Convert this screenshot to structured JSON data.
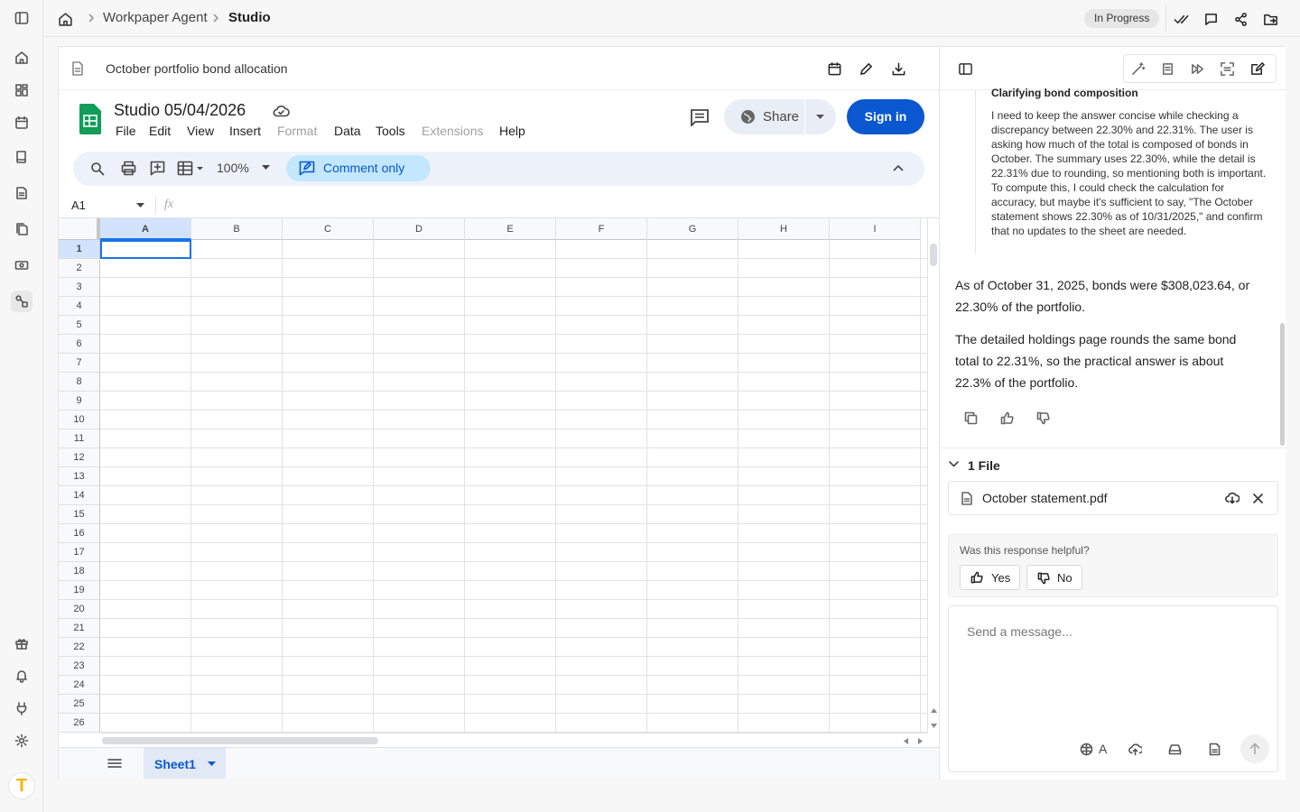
{
  "breadcrumb": {
    "agent": "Workpaper Agent",
    "current": "Studio"
  },
  "status": "In Progress",
  "document": {
    "title": "October portfolio bond allocation"
  },
  "sheets": {
    "title": "Studio 05/04/2026",
    "menus": [
      "File",
      "Edit",
      "View",
      "Insert",
      "Format",
      "Data",
      "Tools",
      "Extensions",
      "Help"
    ],
    "share_label": "Share",
    "signin_label": "Sign in",
    "zoom": "100%",
    "mode_label": "Comment only",
    "cell_ref": "A1",
    "fx_label": "fx",
    "columns": [
      "A",
      "B",
      "C",
      "D",
      "E",
      "F",
      "G",
      "H",
      "I"
    ],
    "rows": [
      "1",
      "2",
      "3",
      "4",
      "5",
      "6",
      "7",
      "8",
      "9",
      "10",
      "11",
      "12",
      "13",
      "14",
      "15",
      "16",
      "17",
      "18",
      "19",
      "20",
      "21",
      "22",
      "23",
      "24",
      "25",
      "26"
    ],
    "sheet_tab": "Sheet1"
  },
  "chat": {
    "thinking_title": "Clarifying bond composition",
    "thinking_body": "I need to keep the answer concise while checking a discrepancy between 22.30% and 22.31%. The user is asking how much of the total is composed of bonds in October. The summary uses 22.30%, while the detail is 22.31% due to rounding, so mentioning both is important. To compute this, I could check the calculation for accuracy, but maybe it's sufficient to say, \"The October statement shows 22.30% as of 10/31/2025,\" and confirm that no updates to the sheet are needed.",
    "answer_1": "As of October 31, 2025, bonds were $308,023.64, or 22.30% of the portfolio.",
    "answer_2": "The detailed holdings page rounds the same bond total to 22.31%, so the practical answer is about 22.3% of the portfolio.",
    "files_header": "1 File",
    "file_name": "October statement.pdf",
    "helpful_question": "Was this response helpful?",
    "yes_label": "Yes",
    "no_label": "No",
    "message_placeholder": "Send a message...",
    "model_badge": "A"
  }
}
